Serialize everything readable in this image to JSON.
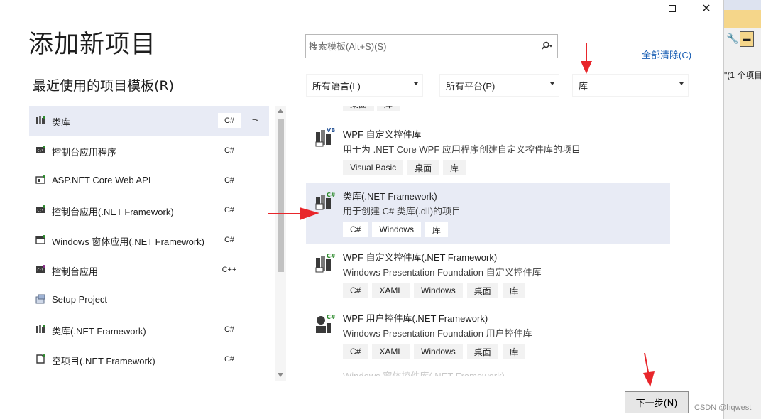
{
  "page_title": "添加新项目",
  "recent_title": "最近使用的项目模板(R)",
  "search": {
    "placeholder": "搜索模板(Alt+S)(S)",
    "icon": "search-icon"
  },
  "clear_all": "全部清除(C)",
  "filters": {
    "language": "所有语言(L)",
    "platform": "所有平台(P)",
    "project_type": "库"
  },
  "recent_items": [
    {
      "label": "类库",
      "lang": "C#",
      "icon": "class-library-icon",
      "pinned": true,
      "selected": true
    },
    {
      "label": "控制台应用程序",
      "lang": "C#",
      "icon": "console-app-icon"
    },
    {
      "label": "ASP.NET Core Web API",
      "lang": "C#",
      "icon": "web-api-icon"
    },
    {
      "label": "控制台应用(.NET Framework)",
      "lang": "C#",
      "icon": "console-app-icon"
    },
    {
      "label": "Windows 窗体应用(.NET Framework)",
      "lang": "C#",
      "icon": "windows-forms-icon"
    },
    {
      "label": "控制台应用",
      "lang": "C++",
      "icon": "console-app-icon"
    },
    {
      "label": "Setup Project",
      "lang": "",
      "icon": "setup-project-icon"
    },
    {
      "label": "类库(.NET Framework)",
      "lang": "C#",
      "icon": "class-library-icon"
    },
    {
      "label": "空项目(.NET Framework)",
      "lang": "C#",
      "icon": "empty-project-icon"
    }
  ],
  "templates": [
    {
      "name": "WPF 自定义控件库",
      "desc": "用于为 .NET Core WPF 应用程序创建自定义控件库的项目",
      "tags": [
        "Visual Basic",
        "桌面",
        "库"
      ],
      "badge": "VB",
      "icon": "wpf-control-library-icon"
    },
    {
      "name": "类库(.NET Framework)",
      "desc": "用于创建 C# 类库(.dll)的项目",
      "tags": [
        "C#",
        "Windows",
        "库"
      ],
      "badge": "C#",
      "icon": "class-library-icon",
      "selected": true
    },
    {
      "name": "WPF 自定义控件库(.NET Framework)",
      "desc": "Windows Presentation Foundation 自定义控件库",
      "tags": [
        "C#",
        "XAML",
        "Windows",
        "桌面",
        "库"
      ],
      "badge": "C#",
      "icon": "wpf-control-library-icon"
    },
    {
      "name": "WPF 用户控件库(.NET Framework)",
      "desc": "Windows Presentation Foundation 用户控件库",
      "tags": [
        "C#",
        "XAML",
        "Windows",
        "桌面",
        "库"
      ],
      "badge": "C#",
      "icon": "wpf-user-control-library-icon"
    }
  ],
  "partial_top_tags": [
    "桌面",
    "库"
  ],
  "partial_bottom_name": "Windows 窗体控件库(.NET Framework)",
  "next_button": "下一步(N)",
  "background_window": {
    "text": "\"(1 个项目"
  },
  "watermark": "CSDN @hqwest",
  "colors": {
    "accent_link": "#1a5fb4",
    "selection": "#e8ebf5",
    "annotation_arrow": "#e8262b",
    "csharp_badge": "#2c8a2c",
    "vb_badge": "#2b5797"
  }
}
